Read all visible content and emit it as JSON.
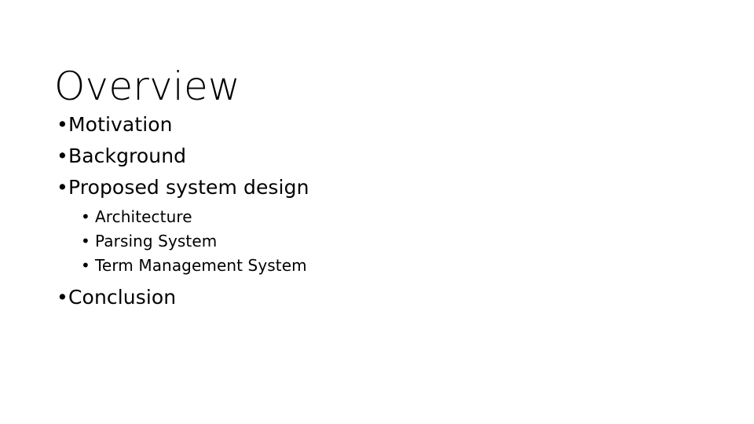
{
  "slide": {
    "title": "Overview",
    "background_color": "#ffffff",
    "text_color": "#000000",
    "bullet_glyph": "•",
    "outline": [
      {
        "level": 1,
        "label": "Motivation"
      },
      {
        "level": 1,
        "label": "Background"
      },
      {
        "level": 1,
        "label": "Proposed system design"
      },
      {
        "level": 2,
        "label": "Architecture"
      },
      {
        "level": 2,
        "label": "Parsing System"
      },
      {
        "level": 2,
        "label": "Term Management System"
      },
      {
        "level": 1,
        "label": "Conclusion"
      }
    ]
  }
}
